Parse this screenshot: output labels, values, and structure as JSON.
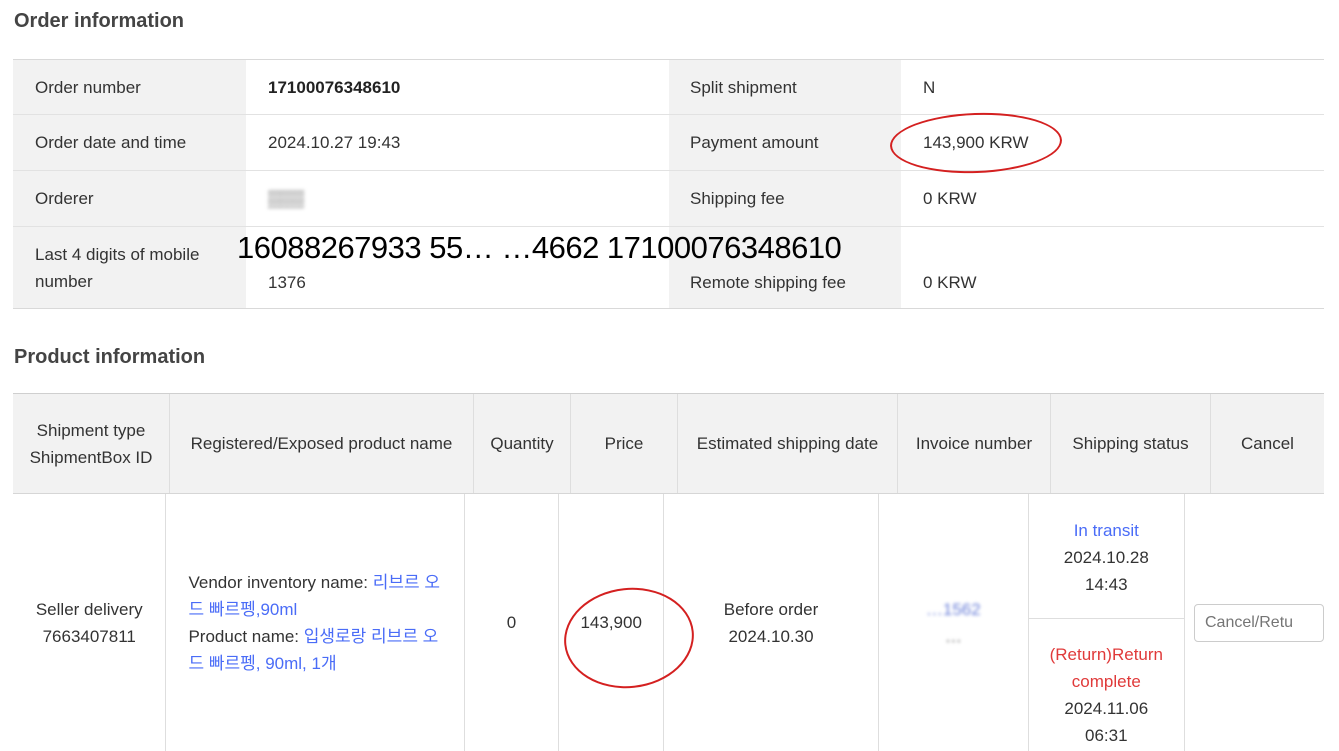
{
  "order_section": {
    "title": "Order information",
    "rows": [
      {
        "label": "Order number",
        "value": "17100076348610",
        "label2": "Split shipment",
        "value2": "N"
      },
      {
        "label": "Order date and time",
        "value": "2024.10.27 19:43",
        "label2": "Payment amount",
        "value2": "143,900 KRW"
      },
      {
        "label": "Orderer",
        "value": "",
        "label2": "Shipping fee",
        "value2": "0 KRW"
      },
      {
        "label": "Last 4 digits of mobile number",
        "value": "1376",
        "label2": "Remote shipping fee",
        "value2": "0 KRW"
      }
    ]
  },
  "overlay": {
    "text": "16088267933 55…  …4662 17100076348610"
  },
  "product_section": {
    "title": "Product information",
    "headers": {
      "shipment_type": "Shipment type ShipmentBox ID",
      "product_name": "Registered/Exposed product name",
      "quantity": "Quantity",
      "price": "Price",
      "estimated_shipping": "Estimated shipping date",
      "invoice": "Invoice number",
      "shipping_status": "Shipping status",
      "cancel": "Cancel"
    },
    "row": {
      "shipment_type": "Seller delivery",
      "shipmentbox_id": "7663407811",
      "vendor_label": "Vendor inventory name: ",
      "vendor_value": "리브르 오 드 빠르펭,90ml",
      "product_label": "Product name: ",
      "product_value": "입생로랑 리브르 오 드 빠르펭, 90ml, 1개",
      "quantity": "0",
      "price": "143,900",
      "est_label": "Before order",
      "est_date": "2024.10.30",
      "invoice_line1": "…1562",
      "invoice_line2": "…",
      "status1": "In transit",
      "status1_date": "2024.10.28",
      "status1_time": "14:43",
      "status2": "(Return)Return complete",
      "status2_date": "2024.11.06",
      "status2_time": "06:31",
      "cancel_placeholder": "Cancel/Retu"
    }
  },
  "colors": {
    "link": "#4a6cf7",
    "annotation": "#d42020",
    "status_red": "#e03a3a"
  }
}
